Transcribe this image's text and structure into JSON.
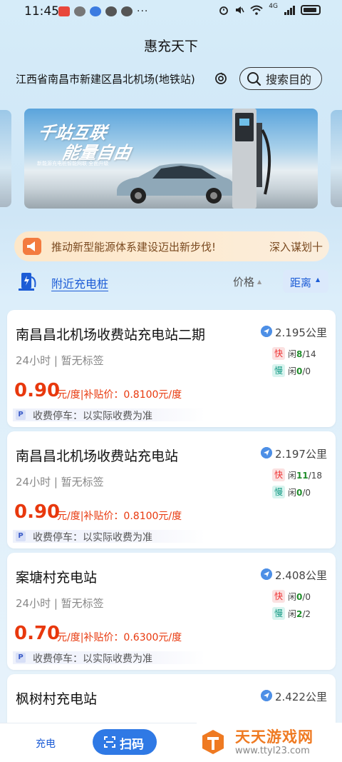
{
  "status_bar": {
    "time": "11:45",
    "network": "4G",
    "icons": [
      "app-notify-icon",
      "vpn-icon",
      "message-icon",
      "wechat-icon",
      "alarm-icon",
      "mute-icon",
      "wifi-icon",
      "signal-icon",
      "battery-icon"
    ]
  },
  "app": {
    "title": "惠充天下"
  },
  "header": {
    "location": "江西省南昌市新建区昌北机场(地铁站)",
    "search_placeholder": "搜索目的"
  },
  "banner": {
    "line1": "千站互联",
    "line2": "能量自由",
    "subtitle": "新能源充电桩智能网联 全面升级"
  },
  "notice": {
    "text": "推动新型能源体系建设迈出新步伐!",
    "text_right": "深入谋划十"
  },
  "filter": {
    "nearby": "附近充电桩",
    "price": "价格",
    "distance": "距离",
    "accent": "#1c5cd6"
  },
  "stations": [
    {
      "name": "南昌昌北机场收费站充电站二期",
      "meta": "24小时 | 暂无标签",
      "price": "0.90",
      "price_rest": "元/度|补贴价：0.8100元/度",
      "parking": "收费停车：以实际收费为准",
      "distance": "2.195公里",
      "fast_label": "快",
      "fast_prefix": "闲",
      "fast_free": "8",
      "fast_total": "/14",
      "slow_label": "慢",
      "slow_prefix": "闲",
      "slow_free": "0",
      "slow_total": "/0"
    },
    {
      "name": "南昌昌北机场收费站充电站",
      "meta": "24小时 | 暂无标签",
      "price": "0.90",
      "price_rest": "元/度|补贴价：0.8100元/度",
      "parking": "收费停车：以实际收费为准",
      "distance": "2.197公里",
      "fast_label": "快",
      "fast_prefix": "闲",
      "fast_free": "11",
      "fast_total": "/18",
      "slow_label": "慢",
      "slow_prefix": "闲",
      "slow_free": "0",
      "slow_total": "/0"
    },
    {
      "name": "案塘村充电站",
      "meta": "24小时 | 暂无标签",
      "price": "0.70",
      "price_rest": "元/度|补贴价：0.6300元/度",
      "parking": "收费停车：以实际收费为准",
      "distance": "2.408公里",
      "fast_label": "快",
      "fast_prefix": "闲",
      "fast_free": "0",
      "fast_total": "/0",
      "slow_label": "慢",
      "slow_prefix": "闲",
      "slow_free": "2",
      "slow_total": "/2"
    },
    {
      "name": "枫树村充电站",
      "distance": "2.422公里"
    }
  ],
  "bottom_nav": {
    "charge": "充电",
    "scan": "扫码"
  },
  "watermark": {
    "name": "天天游戏网",
    "url": "www.ttyl23.com"
  }
}
